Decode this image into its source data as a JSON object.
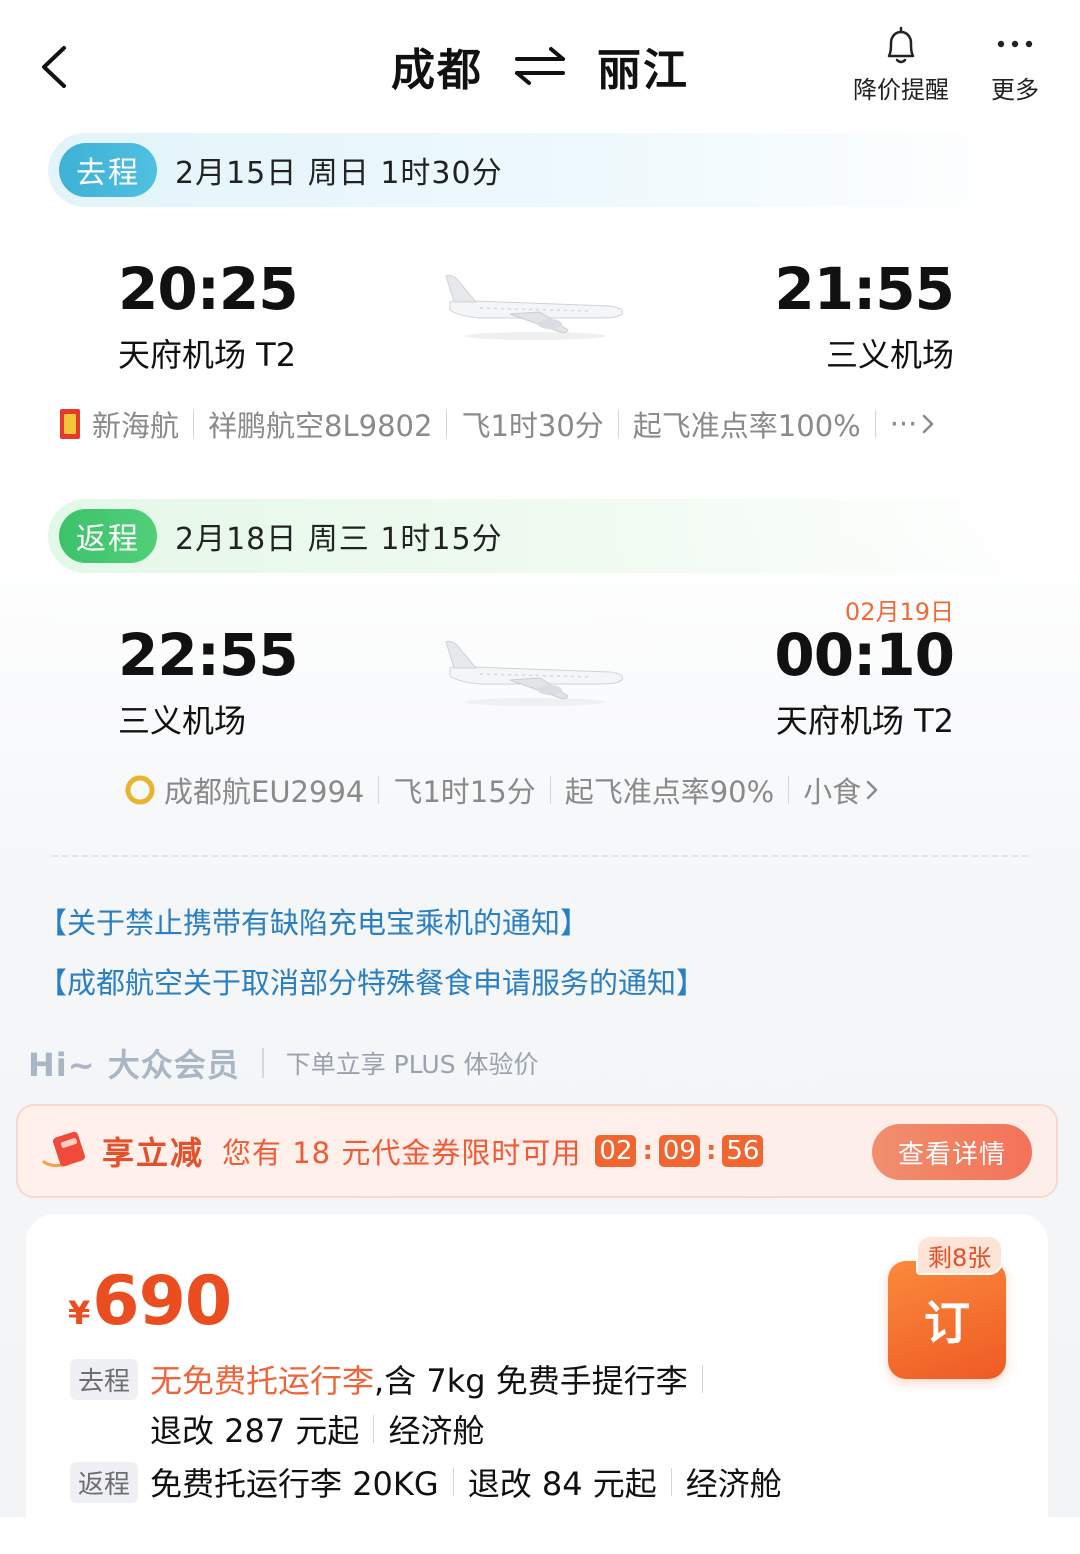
{
  "header": {
    "origin": "成都",
    "destination": "丽江",
    "price_alert_label": "降价提醒",
    "more_label": "更多"
  },
  "outbound": {
    "tag": "去程",
    "summary": "2月15日  周日   1时30分",
    "dep_time": "20:25",
    "dep_airport": "天府机场 T2",
    "arr_time": "21:55",
    "arr_airport": "三义机场",
    "info": [
      "新海航",
      "祥鹏航空8L9802",
      "飞1时30分",
      "起飞准点率100%",
      "···"
    ]
  },
  "return": {
    "tag": "返程",
    "summary": "2月18日  周三   1时15分",
    "dep_time": "22:55",
    "dep_airport": "三义机场",
    "arr_date": "02月19日",
    "arr_time": "00:10",
    "arr_airport": "天府机场 T2",
    "info": [
      "成都航EU2994",
      "飞1时15分",
      "起飞准点率90%",
      "小食"
    ]
  },
  "notices": [
    "【关于禁止携带有缺陷充电宝乘机的通知】",
    "【成都航空关于取消部分特殊餐食申请服务的通知】"
  ],
  "member": {
    "greeting": "Hi~ 大众会员",
    "subtitle": "下单立享 PLUS 体验价"
  },
  "promo": {
    "title": "享立减",
    "text": "您有 18 元代金券限时可用",
    "countdown": [
      "02",
      "09",
      "56"
    ],
    "button": "查看详情"
  },
  "fare": {
    "currency": "¥",
    "price": "690",
    "remaining": "剩8张",
    "book_label": "订",
    "outbound_tag": "去程",
    "outbound_baggage": "无免费托运行李",
    "outbound_carry": ",含 7kg 免费手提行李",
    "outbound_change": "退改 287 元起",
    "outbound_cabin": "经济舱",
    "return_tag": "返程",
    "return_baggage": "免费托运行李 20KG",
    "return_change": "退改 84 元起",
    "return_cabin": "经济舱"
  },
  "colors": {
    "accent_orange": "#ea4e20",
    "link_blue": "#2a7fc2",
    "outbound_tag": "#3fb1d6",
    "return_tag": "#3cc26a"
  }
}
